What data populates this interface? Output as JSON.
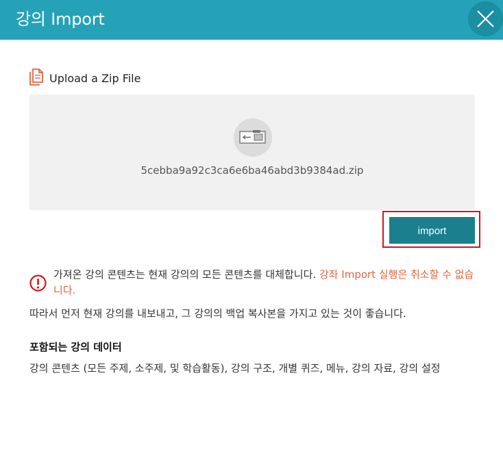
{
  "header": {
    "title": "강의 Import",
    "close_icon": "close-icon",
    "color": "#25a2b7"
  },
  "upload": {
    "label": "Upload a Zip File",
    "icon": "files-icon",
    "file_icon": "zip-file-icon",
    "file_name": "5cebba9a92c3ca6e6ba46abd3b9384ad.zip"
  },
  "import_button": {
    "label": "import",
    "color": "#1b7f8e",
    "highlight_color": "#d9121b"
  },
  "warning": {
    "icon": "warning-icon",
    "text": "가져온 강의 콘텐츠는 현재 강의의 모든 콘텐츠를 대체합니다. ",
    "highlight": "강좌 Import 실행은 취소할 수 없습니다.",
    "highlight_color": "#e2643f"
  },
  "recommendation": "따라서 먼저 현재 강의를 내보내고, 그 강의의 백업 복사본을 가지고 있는 것이 좋습니다.",
  "included_data": {
    "title": "포함되는 강의 데이터",
    "description": "강의 콘텐츠 (모든 주제, 소주제, 및 학습활동), 강의 구조, 개별 퀴즈, 메뉴, 강의 자료, 강의 설정"
  }
}
